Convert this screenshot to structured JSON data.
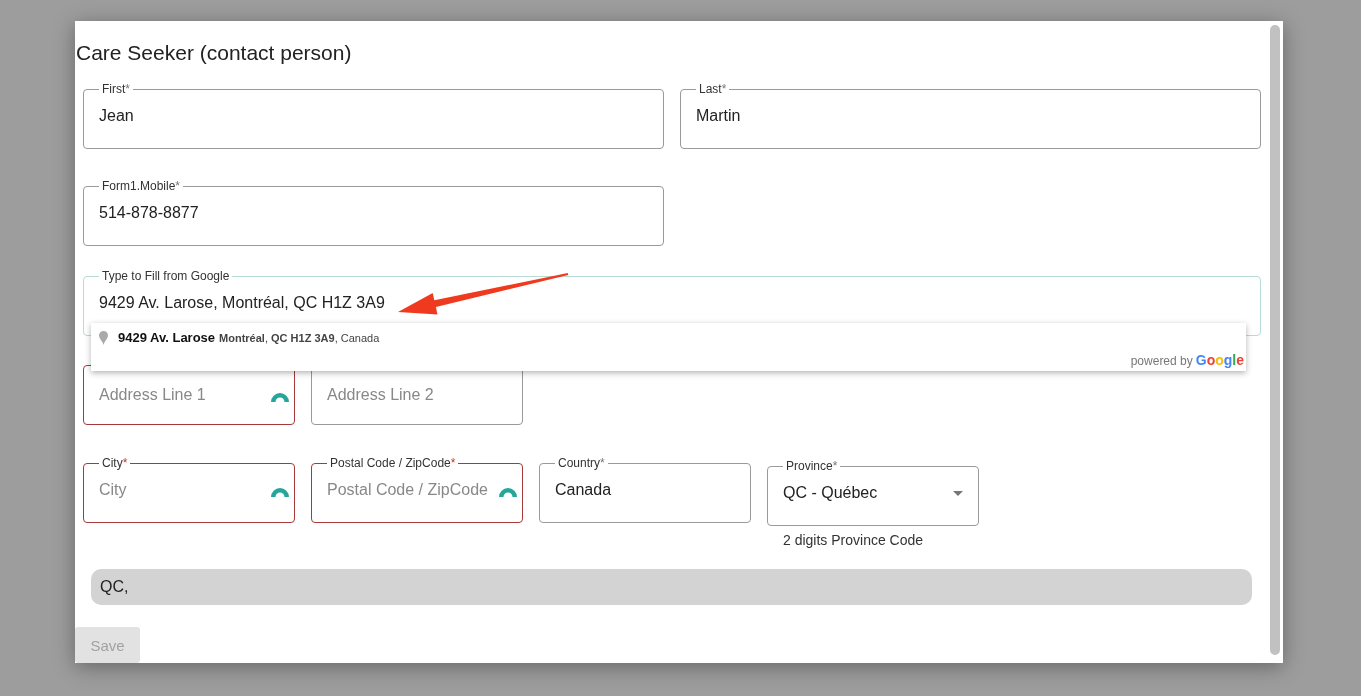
{
  "dialog": {
    "title": "Care Seeker (contact person)"
  },
  "rows": [
    {
      "fields": [
        {
          "kind": "text",
          "label": "First",
          "required_mark": "*",
          "value": "Jean",
          "invalid": false
        },
        {
          "kind": "text",
          "label": "Last",
          "required_mark": "*",
          "value": "Martin",
          "invalid": false
        }
      ]
    },
    {
      "fields": [
        {
          "kind": "text",
          "label": "Form1.Mobile",
          "required_mark": "*",
          "value": "514-878-8877",
          "invalid": false
        }
      ]
    },
    {
      "fields": [
        {
          "kind": "autocomplete",
          "label": "Type to Fill from Google",
          "value": "9429 Av. Larose, Montréal, QC H1Z 3A9",
          "focused": true,
          "suggestions": [
            {
              "main": "9429 Av. Larose",
              "secondary": "**Montréal**, **QC H1Z 3A9**, Canada"
            }
          ],
          "attribution": {
            "prefix": "powered by",
            "brand": "Google"
          }
        }
      ]
    },
    {
      "fields": [
        {
          "kind": "text",
          "placeholder": "Address Line 1",
          "invalid": true,
          "loading": true
        },
        {
          "kind": "text",
          "placeholder": "Address Line 2",
          "invalid": false,
          "loading": false
        }
      ]
    },
    {
      "fields": [
        {
          "kind": "text",
          "label": "City",
          "required_mark": "*",
          "placeholder": "City",
          "invalid": true,
          "loading": true
        },
        {
          "kind": "text",
          "label": "Postal Code / ZipCode",
          "required_mark": "*",
          "placeholder": "Postal Code / ZipCode",
          "invalid": true,
          "loading": true
        },
        {
          "kind": "text",
          "label": "Country",
          "required_mark": "*",
          "value": "Canada",
          "invalid": false
        },
        {
          "kind": "select",
          "label": "Province",
          "required_mark": "*",
          "value": "QC - Québec",
          "helper": "2 digits Province Code",
          "invalid": false
        }
      ]
    }
  ],
  "summary": "QC,",
  "save_button": {
    "label": "Save",
    "disabled": true
  }
}
